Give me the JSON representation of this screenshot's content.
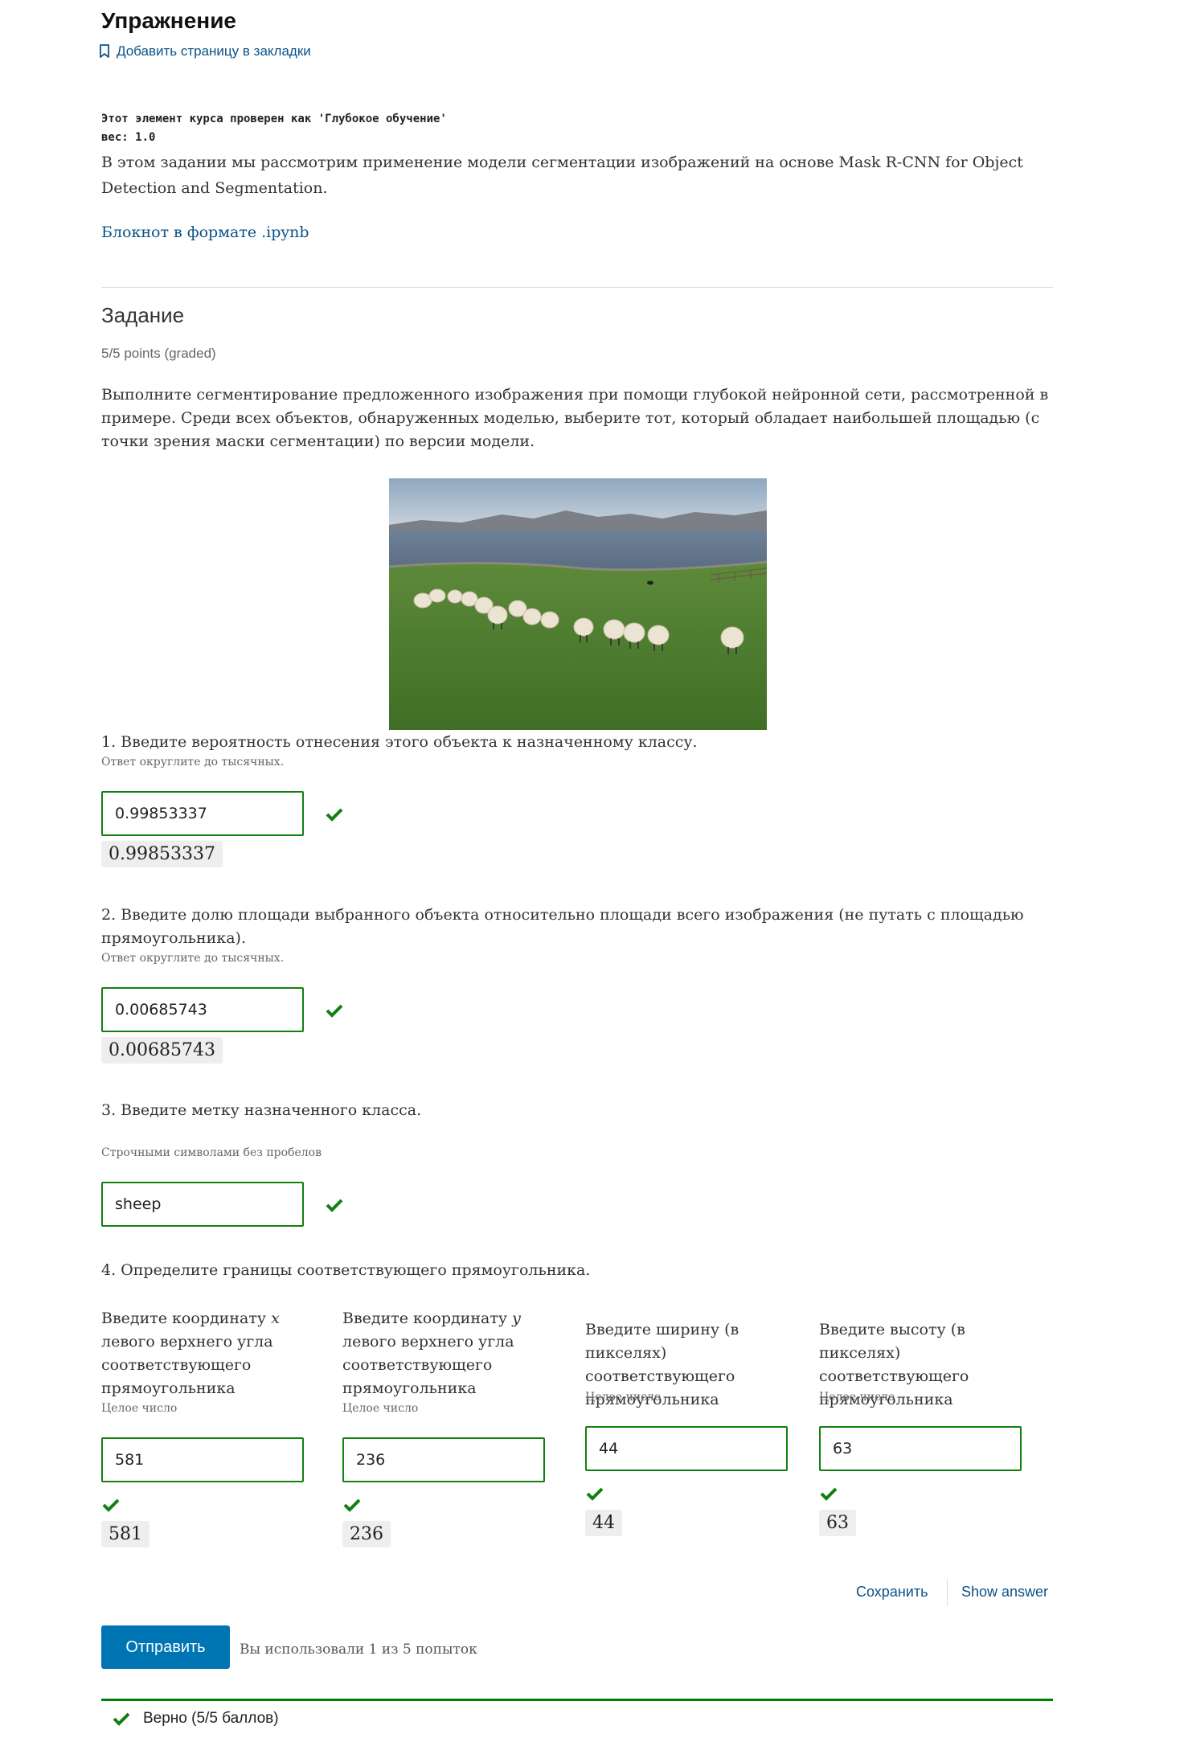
{
  "header": {
    "title": "Упражнение",
    "bookmark_label": "Добавить страницу в закладки"
  },
  "graded_note": {
    "line1": "Этот элемент курса проверен как 'Глубокое обучение'",
    "line2": "вес: 1.0"
  },
  "intro": "В этом задании мы рассмотрим применение модели сегментации изображений на основе Mask R-CNN for Object Detection and Segmentation.",
  "notebook_link": "Блокнот в формате .ipynb",
  "problem": {
    "title": "Задание",
    "points": "5/5 points (graded)",
    "task": "Выполните сегментирование предложенного изображения при помощи глубокой нейронной сети, рассмотренной в примере. Среди всех объектов, обнаруженных моделью, выберите тот, который обладает наибольшей площадью (с точки зрения маски сегментации) по версии модели."
  },
  "questions": {
    "q1": {
      "label": "1. Введите вероятность отнесения этого объекта к назначенному классу.",
      "hint": "Ответ округлите до тысячных.",
      "value": "0.99853337",
      "echo": "0.99853337"
    },
    "q2": {
      "label": "2. Введите долю площади выбранного объекта относительно площади всего изображения (не путать с площадью прямоугольника).",
      "hint": "Ответ округлите до тысячных.",
      "value": "0.00685743",
      "echo": "0.00685743"
    },
    "q3": {
      "label": "3. Введите метку назначенного класса.",
      "hint": "Строчными символами без пробелов",
      "value": "sheep"
    },
    "q4": {
      "label": "4. Определите границы соответствующего прямоугольника.",
      "fields": [
        {
          "pre": "Введите координату ",
          "var": "x",
          "post": " левого верхнего угла соответствующего прямоугольника",
          "hint": "Целое число",
          "value": "581",
          "echo": "581"
        },
        {
          "pre": "Введите координату ",
          "var": "y",
          "post": " левого верхнего угла соответствующего прямоугольника",
          "hint": "Целое число",
          "value": "236",
          "echo": "236"
        },
        {
          "pre": "Введите ширину (в пикселях) соответствующего прямоугольника",
          "hint": "Целое число",
          "value": "44",
          "echo": "44"
        },
        {
          "pre": "Введите высоту (в пикселях) соответствующего прямоугольника",
          "hint": "Целое число",
          "value": "63",
          "echo": "63"
        }
      ]
    }
  },
  "actions": {
    "save": "Сохранить",
    "show_answer": "Show answer",
    "submit": "Отправить",
    "attempts": "Вы использовали 1 из 5 попыток"
  },
  "result": {
    "text": "Верно (5/5 баллов)"
  },
  "colors": {
    "correct": "#118011",
    "link": "#0a5288",
    "submit": "#0075b4"
  },
  "icons": [
    "bookmark-icon",
    "checkmark-icon"
  ]
}
